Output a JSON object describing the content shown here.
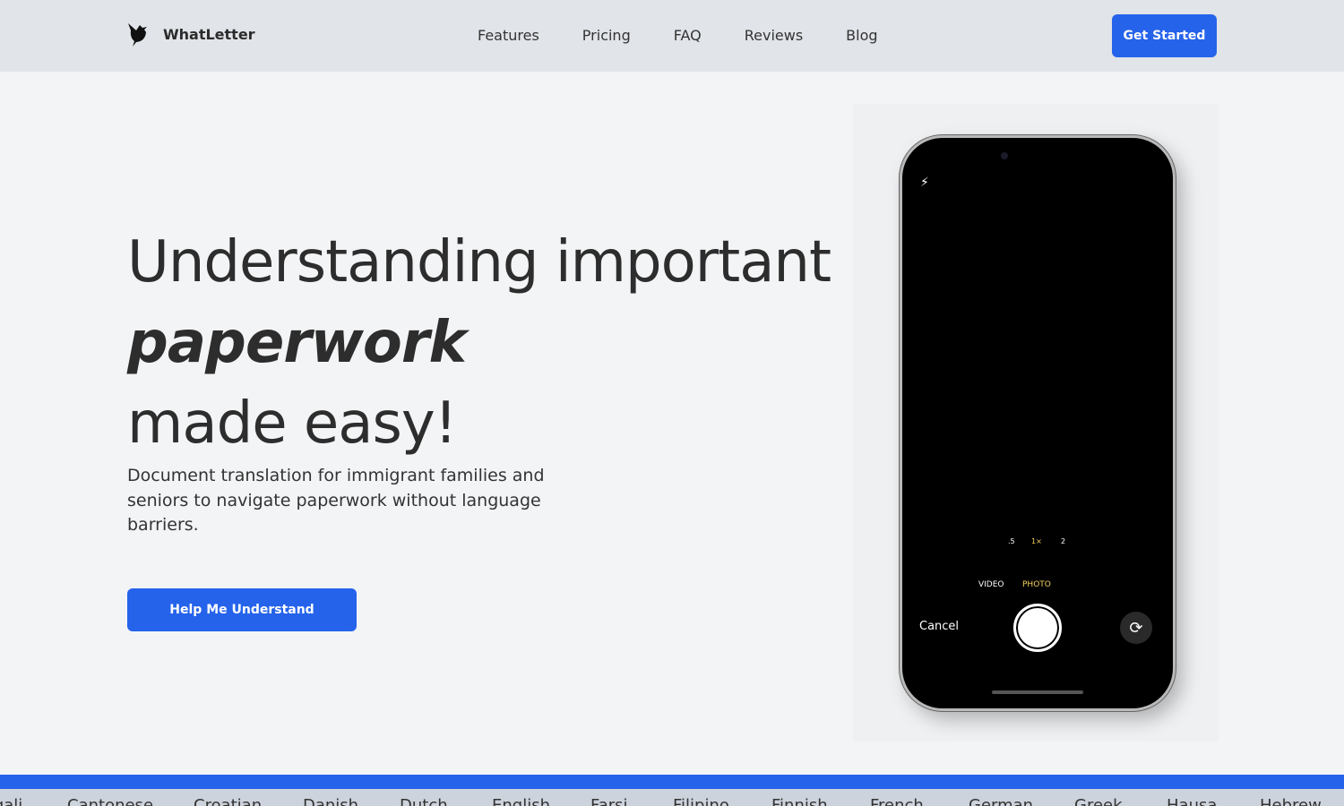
{
  "nav": {
    "brand": "WhatLetter",
    "links": [
      "Features",
      "Pricing",
      "FAQ",
      "Reviews",
      "Blog"
    ],
    "cta": "Get Started"
  },
  "hero": {
    "line1": "Understanding important",
    "line2": "paperwork",
    "line3": "made easy!",
    "subtitle": "Document translation for immigrant families and seniors to navigate paperwork without language barriers.",
    "button": "Help Me Understand"
  },
  "phone": {
    "zoom": [
      ".5",
      "1×",
      "2"
    ],
    "modes": [
      "VIDEO",
      "PHOTO"
    ],
    "cancel": "Cancel",
    "accent": "#f5d05a"
  },
  "languages": [
    "Bengali",
    "Cantonese",
    "Croatian",
    "Danish",
    "Dutch",
    "English",
    "Farsi",
    "Filipino",
    "Finnish",
    "French",
    "German",
    "Greek",
    "Hausa",
    "Hebrew"
  ],
  "colors": {
    "primary": "#2563eb"
  }
}
